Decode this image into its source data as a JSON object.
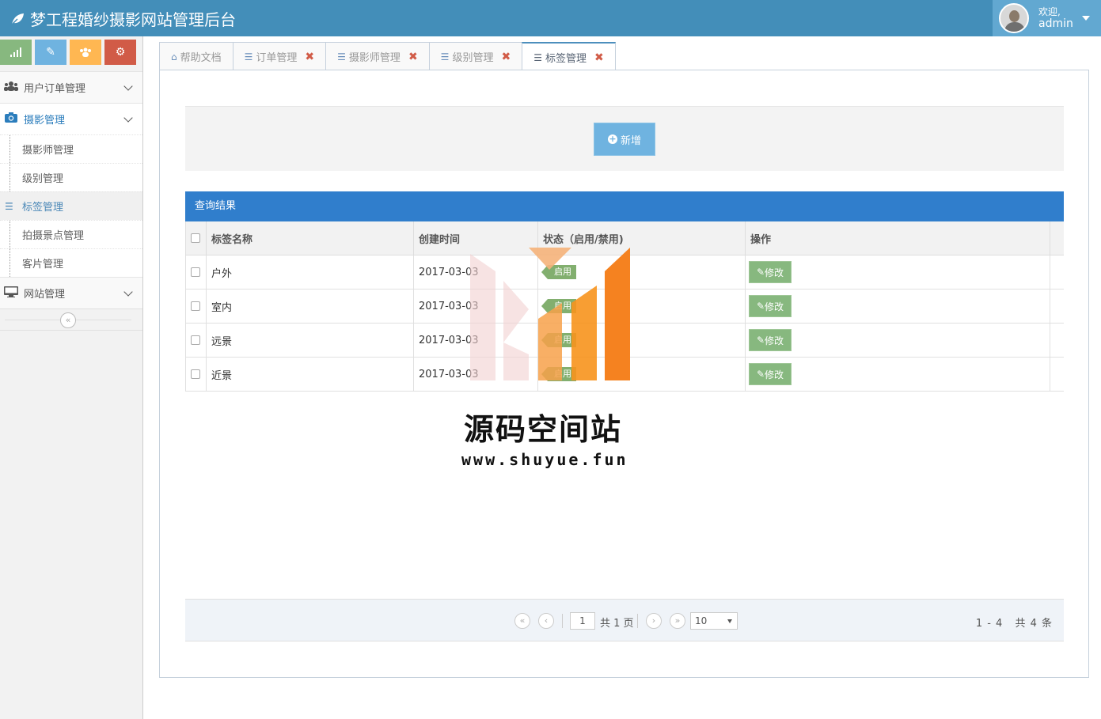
{
  "header": {
    "title": "梦工程婚纱摄影网站管理后台",
    "welcome": "欢迎,",
    "username": "admin"
  },
  "sidebar": {
    "shortcuts": [
      {
        "icon": "signal-icon",
        "color": "#87b87f"
      },
      {
        "icon": "pencil-icon",
        "color": "#6fb3e0"
      },
      {
        "icon": "group-icon",
        "color": "#ffb752"
      },
      {
        "icon": "cogs-icon",
        "color": "#d15b47"
      }
    ],
    "menu": [
      {
        "label": "用户订单管理",
        "icon": "users-icon"
      },
      {
        "label": "摄影管理",
        "icon": "camera-icon"
      },
      {
        "label": "网站管理",
        "icon": "desktop-icon"
      }
    ],
    "submenu": [
      "摄影师管理",
      "级别管理",
      "标签管理",
      "拍摄景点管理",
      "客片管理"
    ]
  },
  "tabs": [
    {
      "label": "帮助文档",
      "icon": "home-icon",
      "closable": false
    },
    {
      "label": "订单管理",
      "icon": "sliders-icon",
      "closable": true
    },
    {
      "label": "摄影师管理",
      "icon": "sliders-icon",
      "closable": true
    },
    {
      "label": "级别管理",
      "icon": "sliders-icon",
      "closable": true
    },
    {
      "label": "标签管理",
      "icon": "sliders-icon",
      "closable": true,
      "active": true
    }
  ],
  "toolbar": {
    "add_label": "新增"
  },
  "results": {
    "title": "查询结果",
    "columns": [
      "标签名称",
      "创建时间",
      "状态（启用/禁用)",
      "操作"
    ],
    "rows": [
      {
        "name": "户外",
        "created": "2017-03-03",
        "status": "启用",
        "action": "修改"
      },
      {
        "name": "室内",
        "created": "2017-03-03",
        "status": "启用",
        "action": "修改"
      },
      {
        "name": "远景",
        "created": "2017-03-03",
        "status": "启用",
        "action": "修改"
      },
      {
        "name": "近景",
        "created": "2017-03-03",
        "status": "启用",
        "action": "修改"
      }
    ]
  },
  "pager": {
    "page": "1",
    "total_pages_label": "共 1 页",
    "page_size": "10",
    "range": "1 - 4",
    "total": "共 4 条"
  },
  "watermark": {
    "title": "源码空间站",
    "url": "www.shuyue.fun"
  },
  "colors": {
    "header": "#438eb9",
    "results_bar": "#307ecc",
    "status_tag": "#82af6f",
    "edit_button": "#87b87f",
    "add_button": "#6fb3e0"
  }
}
